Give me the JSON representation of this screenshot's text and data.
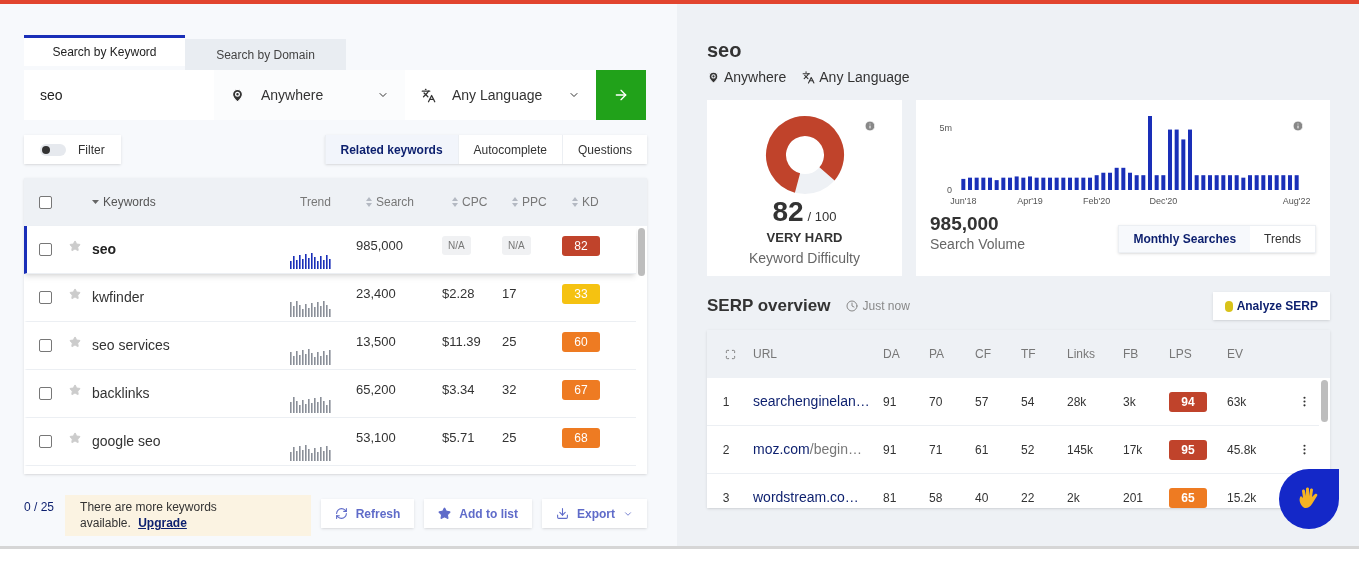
{
  "search_tabs": [
    {
      "label": "Search by Keyword",
      "selected": true
    },
    {
      "label": "Search by Domain",
      "selected": false
    }
  ],
  "search": {
    "value": "seo",
    "location": "Anywhere",
    "language": "Any Language"
  },
  "filter": {
    "label": "Filter",
    "on": false
  },
  "mode_tabs": [
    {
      "label": "Related keywords",
      "selected": true
    },
    {
      "label": "Autocomplete",
      "selected": false
    },
    {
      "label": "Questions",
      "selected": false
    }
  ],
  "keyword_table": {
    "all_checked": false,
    "columns": [
      "Keywords",
      "Trend",
      "Search",
      "CPC",
      "PPC",
      "KD"
    ],
    "rows": [
      {
        "keyword": "seo",
        "search": "985,000",
        "cpc": "N/A",
        "ppc": "N/A",
        "kd": "82",
        "color": "#c0432b",
        "selected": true,
        "checked": false,
        "pending": true
      },
      {
        "keyword": "kwfinder",
        "search": "23,400",
        "cpc": "$2.28",
        "ppc": "17",
        "kd": "33",
        "color": "#f5c211",
        "selected": false,
        "checked": false,
        "pending": false
      },
      {
        "keyword": "seo services",
        "search": "13,500",
        "cpc": "$11.39",
        "ppc": "25",
        "kd": "60",
        "color": "#ee7b22",
        "selected": false,
        "checked": false,
        "pending": false
      },
      {
        "keyword": "backlinks",
        "search": "65,200",
        "cpc": "$3.34",
        "ppc": "32",
        "kd": "67",
        "color": "#ee7b22",
        "selected": false,
        "checked": false,
        "pending": false
      },
      {
        "keyword": "google seo",
        "search": "53,100",
        "cpc": "$5.71",
        "ppc": "25",
        "kd": "68",
        "color": "#ee7b22",
        "selected": false,
        "checked": false,
        "pending": false
      }
    ]
  },
  "selection_count": "0 / 25",
  "notice": {
    "text": "There are more keywords available.",
    "link": "Upgrade"
  },
  "actions": [
    {
      "label": "Refresh",
      "kind": "refresh"
    },
    {
      "label": "Add to list",
      "kind": "star"
    },
    {
      "label": "Export",
      "kind": "export"
    }
  ],
  "keyword": {
    "title": "seo",
    "location": "Anywhere",
    "language": "Any Language"
  },
  "difficulty": {
    "score": "82",
    "max": "/ 100",
    "rating": "VERY HARD",
    "label": "Keyword Difficulty",
    "level": 0.82
  },
  "volume": {
    "value": "985,000",
    "label": "Search Volume",
    "tabs": [
      {
        "label": "Monthly Searches",
        "selected": true
      },
      {
        "label": "Trends",
        "selected": false
      }
    ],
    "chart_data": {
      "type": "bar",
      "categories": [
        "Jun'18",
        null,
        null,
        null,
        null,
        null,
        null,
        null,
        null,
        null,
        "Apr'19",
        null,
        null,
        null,
        null,
        null,
        null,
        null,
        null,
        null,
        "Feb'20",
        null,
        null,
        null,
        null,
        null,
        null,
        null,
        null,
        null,
        "Dec'20",
        null,
        null,
        null,
        null,
        null,
        null,
        null,
        null,
        null,
        null,
        null,
        null,
        null,
        null,
        null,
        null,
        null,
        null,
        null,
        "Aug'22"
      ],
      "series": [
        {
          "color": "#1a2fb8",
          "values": [
            900000,
            1000000,
            1000000,
            1000000,
            1000000,
            800000,
            1000000,
            1000000,
            1100000,
            1000000,
            1100000,
            1000000,
            1000000,
            1000000,
            1000000,
            1000000,
            1000000,
            1000000,
            1000000,
            1000000,
            1200000,
            1400000,
            1400000,
            1800000,
            1800000,
            1400000,
            1200000,
            1200000,
            6000000,
            1200000,
            1200000,
            4900000,
            4900000,
            4100000,
            4900000,
            1200000,
            1200000,
            1200000,
            1200000,
            1200000,
            1200000,
            1200000,
            1000000,
            1200000,
            1200000,
            1200000,
            1200000,
            1200000,
            1200000,
            1200000,
            1200000
          ]
        }
      ],
      "ylim": [
        0,
        6000000
      ],
      "yticks": [
        {
          "value": 0,
          "label": "0"
        },
        {
          "value": 5000000,
          "label": "5m"
        }
      ]
    }
  },
  "serp": {
    "title": "SERP overview",
    "updated": "Just now",
    "analyze_button": "Analyze SERP",
    "columns": [
      "URL",
      "DA",
      "PA",
      "CF",
      "TF",
      "Links",
      "FB",
      "LPS",
      "EV"
    ],
    "rows": [
      {
        "rank": "1",
        "host": "searchenginelan…",
        "da": "91",
        "pa": "70",
        "cf": "57",
        "tf": "54",
        "links": "28k",
        "fb": "3k",
        "lps": "94",
        "color": "#c0432b",
        "ev": "63k",
        "menu": true
      },
      {
        "rank": "2",
        "host": "moz.com",
        "path": "/begin…",
        "da": "91",
        "pa": "71",
        "cf": "61",
        "tf": "52",
        "links": "145k",
        "fb": "17k",
        "lps": "95",
        "color": "#c0432b",
        "ev": "45.8k",
        "menu": true
      },
      {
        "rank": "3",
        "host": "wordstream.co…",
        "da": "81",
        "pa": "58",
        "cf": "40",
        "tf": "22",
        "links": "2k",
        "fb": "201",
        "lps": "65",
        "color": "#ee7b22",
        "ev": "15.2k",
        "menu": false
      }
    ]
  }
}
